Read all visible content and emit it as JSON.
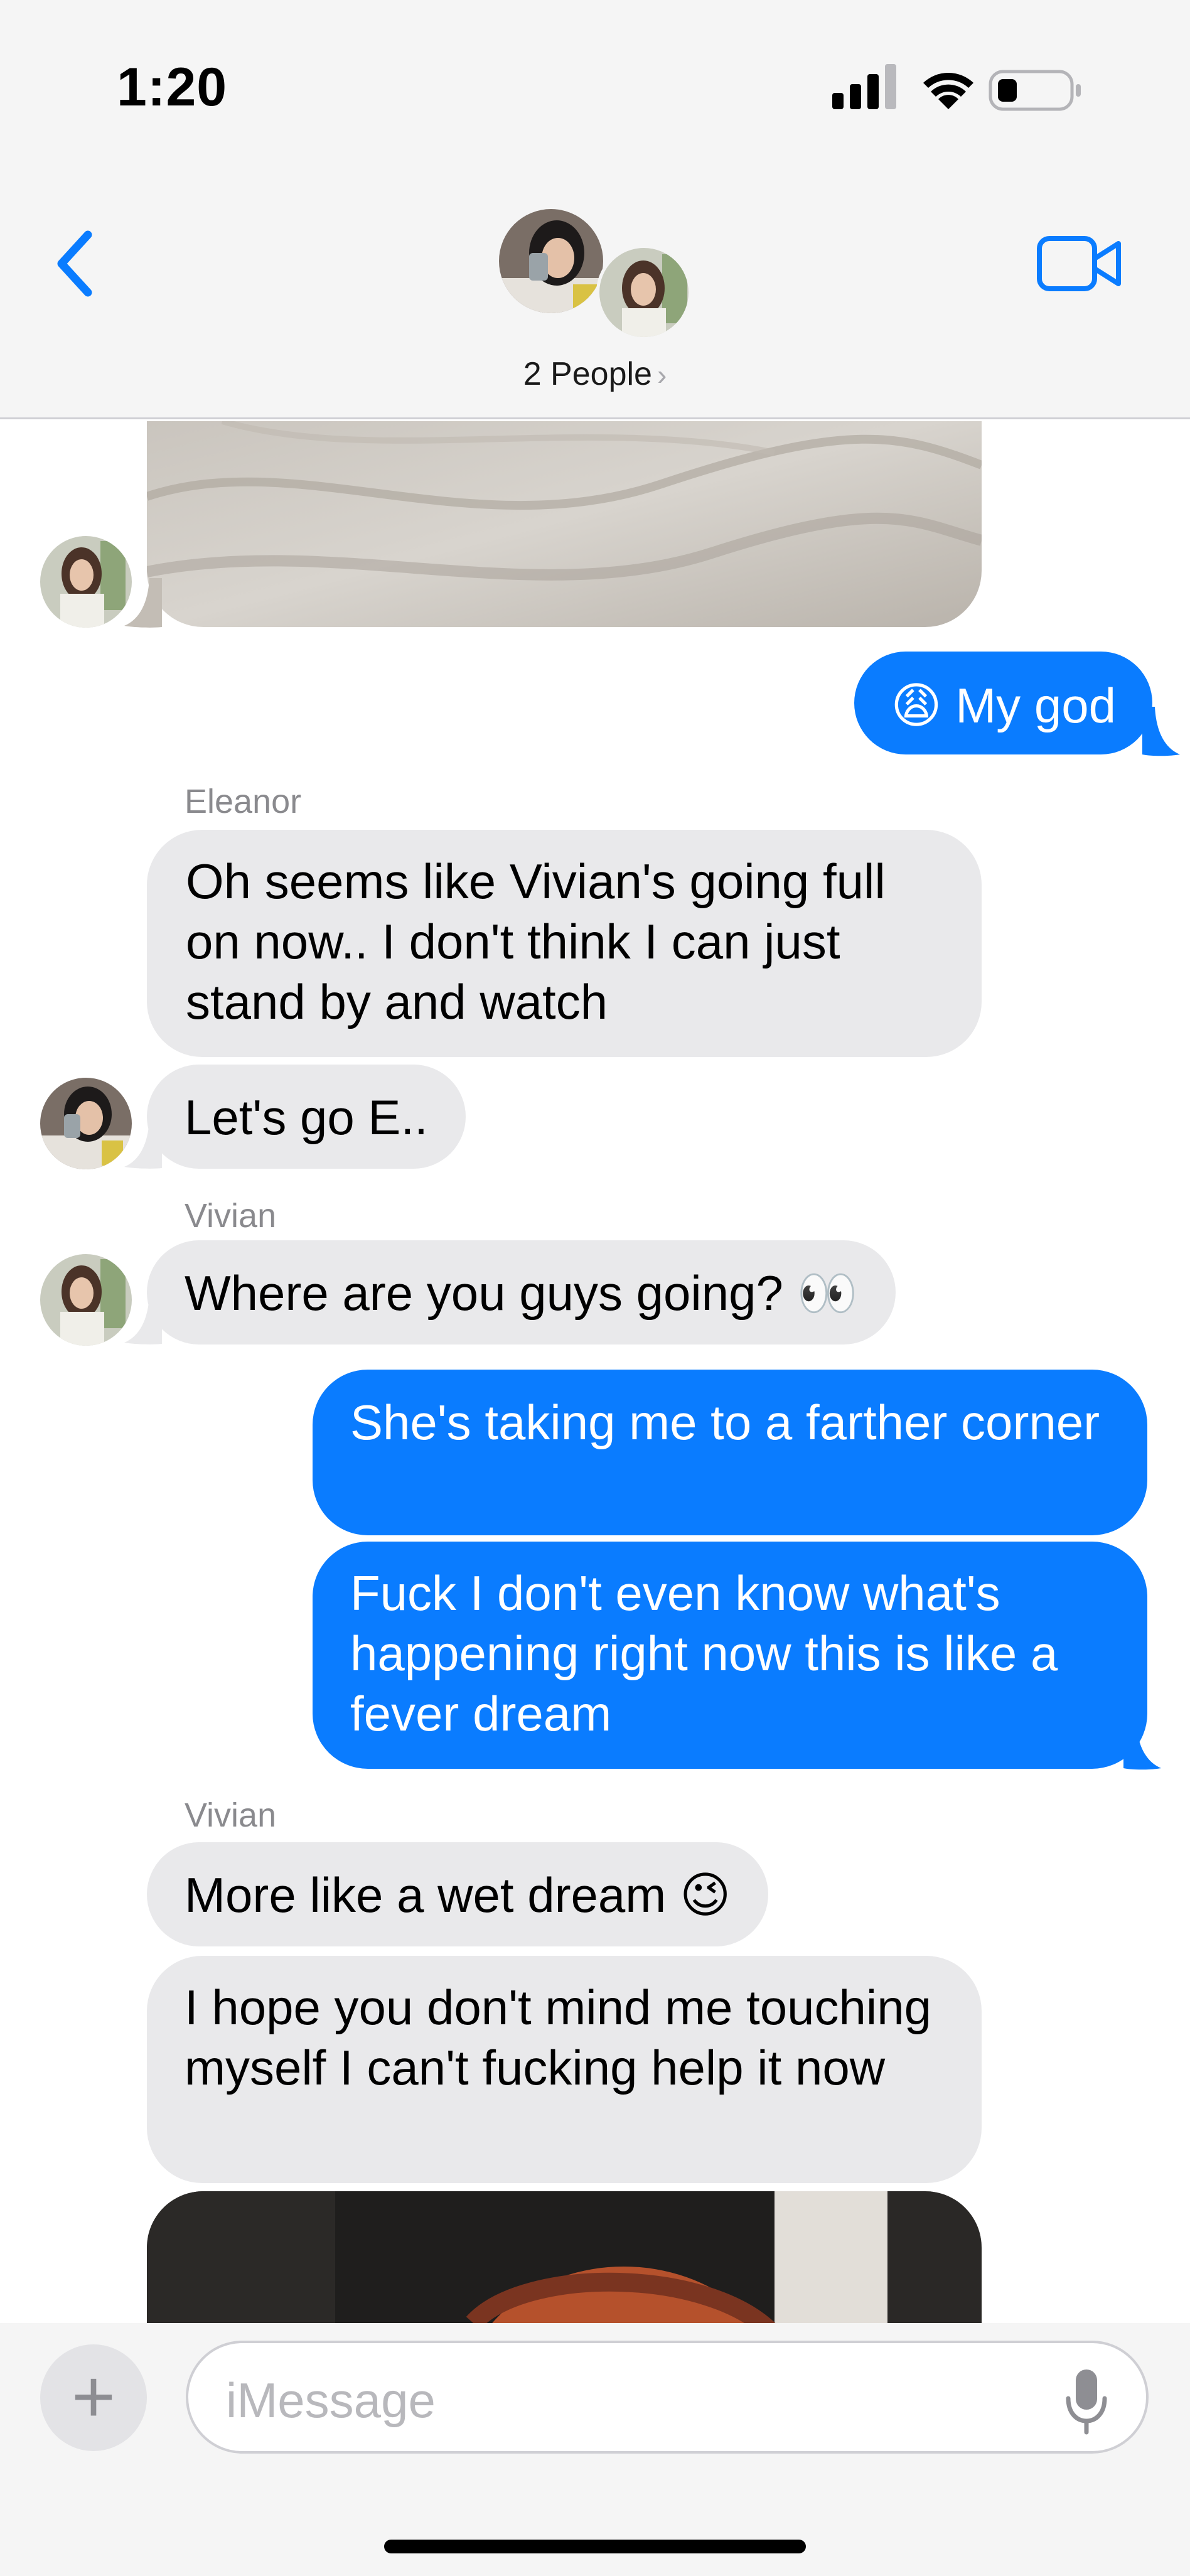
{
  "status_bar": {
    "time": "1:20"
  },
  "header": {
    "people_label": "2 People",
    "chevron": "›"
  },
  "messages": {
    "m1": "😩 My god",
    "eleanor_name": "Eleanor",
    "m2": "Oh seems like Vivian's going full on now.. I don't think I can just stand by and watch",
    "m3": "Let's go E..",
    "vivian_name_1": "Vivian",
    "m4": "Where are you guys going? 👀",
    "m5": "She's taking me to a farther corner",
    "m6": "Fuck I don't even know what's happening right now this is like a fever dream",
    "vivian_name_2": "Vivian",
    "m7": "More like a wet dream 😉",
    "m8": "I hope you don't mind me touching myself I can't fucking help it now"
  },
  "input": {
    "placeholder": "iMessage",
    "plus": "+"
  },
  "colors": {
    "outgoing": "#0a7cff",
    "incoming": "#e9e9eb",
    "accent": "#0a7cff"
  }
}
